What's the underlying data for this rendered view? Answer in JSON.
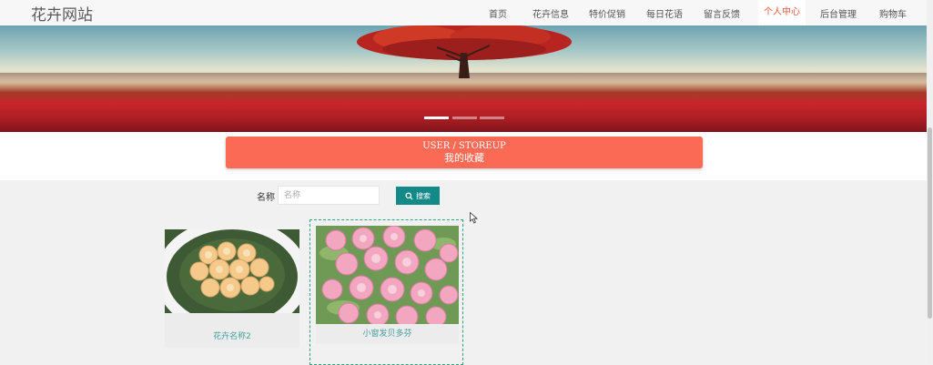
{
  "site": {
    "brand": "花卉网站"
  },
  "nav": {
    "items": [
      {
        "label": "首页",
        "active": false
      },
      {
        "label": "花卉信息",
        "active": false
      },
      {
        "label": "特价促销",
        "active": false
      },
      {
        "label": "每日花语",
        "active": false
      },
      {
        "label": "留言反馈",
        "active": false
      },
      {
        "label": "个人中心",
        "active": true
      },
      {
        "label": "后台管理",
        "active": false
      },
      {
        "label": "购物车",
        "active": false
      }
    ]
  },
  "banner": {
    "slide_count": 3,
    "active_slide": 1
  },
  "section": {
    "title_en": "USER / STOREUP",
    "title_cn": "我的收藏"
  },
  "search": {
    "label": "名称",
    "placeholder": "名称",
    "value": "",
    "button_label": "搜索"
  },
  "favorites": [
    {
      "name": "花卉名称2",
      "image": "peach-rose-bouquet",
      "hovered": false
    },
    {
      "name": "小窗发贝多芬",
      "image": "pink-rose-bouquet",
      "hovered": true
    }
  ],
  "colors": {
    "accent": "#fb6a54",
    "nav_active": "#e4553c",
    "search_button": "#138a88",
    "caption_text": "#44a09a",
    "hover_border": "#2aa37d"
  }
}
